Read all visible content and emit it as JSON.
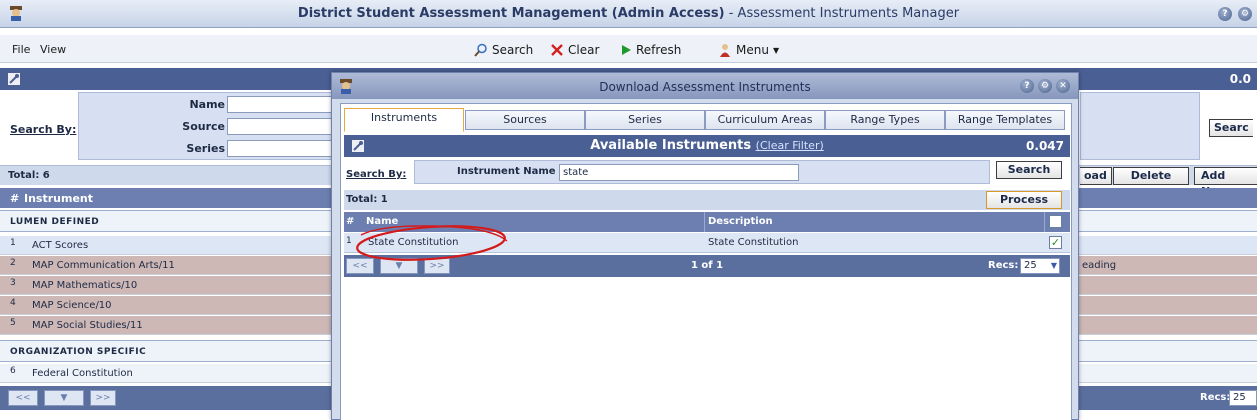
{
  "app": {
    "title_bold": "District Student Assessment Management (Admin Access)",
    "title_rest": " - Assessment Instruments Manager"
  },
  "menu": {
    "file": "File",
    "view": "View",
    "search": "Search",
    "clear": "Clear",
    "refresh": "Refresh",
    "menu": "Menu"
  },
  "main": {
    "ratio": "0.0",
    "search_by": "Search By:",
    "fields": {
      "name": "Name",
      "source": "Source",
      "series": "Series"
    },
    "search_button": "Searc",
    "total": "Total: 6",
    "buttons": {
      "download": "oad",
      "delete": "Delete",
      "add_new": "Add New"
    },
    "columns": {
      "num": "#",
      "instrument": "Instrument"
    },
    "sections": {
      "lumen": "LUMEN DEFINED",
      "org": "ORGANIZATION SPECIFIC"
    },
    "rows": [
      {
        "num": "1",
        "name": "ACT Scores",
        "desc": ""
      },
      {
        "num": "2",
        "name": "MAP Communication Arts/11",
        "desc": "eading"
      },
      {
        "num": "3",
        "name": "MAP Mathematics/10",
        "desc": ""
      },
      {
        "num": "4",
        "name": "MAP Science/10",
        "desc": ""
      },
      {
        "num": "5",
        "name": "MAP Social Studies/11",
        "desc": ""
      }
    ],
    "org_rows": [
      {
        "num": "6",
        "name": "Federal Constitution"
      }
    ],
    "pager": {
      "prev": "<<",
      "next": ">>",
      "recs_label": "Recs:",
      "recs_value": "25"
    }
  },
  "dialog": {
    "title": "Download Assessment Instruments",
    "tabs": [
      "Instruments",
      "Sources",
      "Series",
      "Curriculum Areas",
      "Range Types",
      "Range Templates"
    ],
    "header": {
      "title": "Available Instruments",
      "clear_filter": "(Clear Filter)",
      "ratio": "0.047"
    },
    "search_by": "Search By:",
    "field_label": "Instrument Name",
    "field_value": "state",
    "search_button": "Search",
    "total": "Total: 1",
    "process_button": "Process",
    "columns": {
      "num": "#",
      "name": "Name",
      "description": "Description"
    },
    "row": {
      "num": "1",
      "name": "State Constitution",
      "description": "State Constitution",
      "checked": true
    },
    "pager": {
      "prev": "<<",
      "next": ">>",
      "page_info": "1 of 1",
      "recs_label": "Recs:",
      "recs_value": "25"
    }
  },
  "colors": {
    "row_blue": "#dde6f4",
    "row_rose": "#cdb8b6",
    "header_navy": "#4a5f93",
    "highlight_circle": "#d41a1a"
  }
}
